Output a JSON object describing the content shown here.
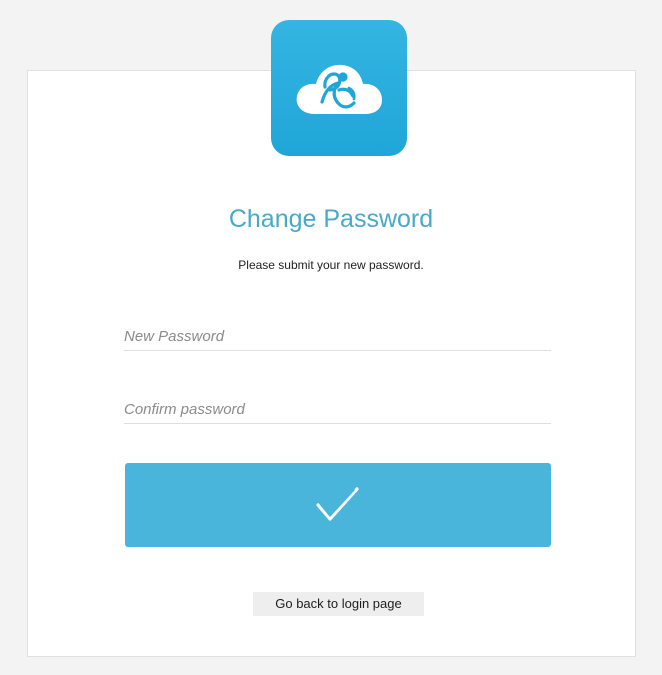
{
  "header": {
    "logo_icon": "cloud-runner-logo-icon",
    "accent_color": "#4ab5da"
  },
  "form": {
    "title": "Change Password",
    "subtitle": "Please submit your new password.",
    "new_password": {
      "value": "",
      "placeholder": "New Password"
    },
    "confirm_password": {
      "value": "",
      "placeholder": "Confirm password"
    },
    "submit_icon": "checkmark-icon"
  },
  "footer": {
    "back_link": "Go back to login page"
  }
}
